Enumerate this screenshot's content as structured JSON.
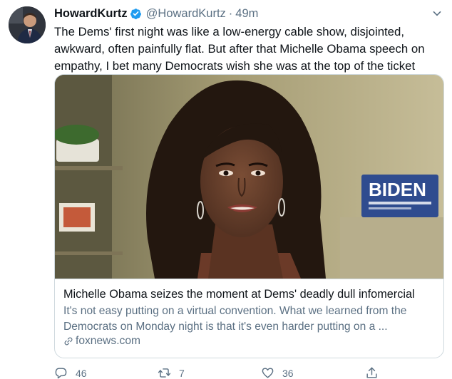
{
  "author": {
    "display_name": "HowardKurtz",
    "handle": "@HowardKurtz",
    "separator": "·",
    "time": "49m",
    "verified": true,
    "avatar_icon": "avatar-photo"
  },
  "tweet": {
    "text": "The Dems' first night was like a low-energy cable show, disjointed, awkward, often painfully flat. But after that Michelle Obama speech on empathy, I bet many Democrats wish she was at the top of the ticket"
  },
  "card": {
    "sign_text": "BIDEN",
    "title": "Michelle Obama seizes the moment at Dems' deadly dull infomercial",
    "description": "It's not easy putting on a virtual convention. What we learned from the Democrats on Monday night is that it's even harder putting on a ...",
    "domain": "foxnews.com"
  },
  "actions": {
    "reply_count": "46",
    "retweet_count": "7",
    "like_count": "36"
  },
  "colors": {
    "verified_blue": "#1d9bf0",
    "muted_text": "#5b7083",
    "border": "#cfd9de"
  }
}
